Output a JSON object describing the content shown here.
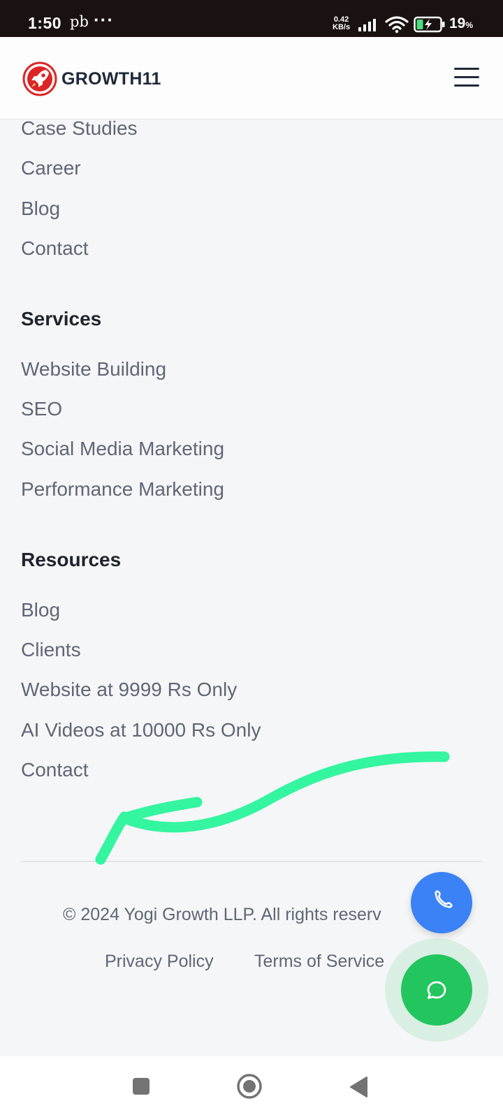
{
  "status_bar": {
    "time": "1:50",
    "carrier": "pb",
    "dots": "···",
    "net_speed_value": "0.42",
    "net_speed_unit": "KB/s",
    "battery_percent": "19",
    "battery_unit": "%"
  },
  "header": {
    "logo_text": "GROWTH11",
    "brand_color": "#dc2626"
  },
  "company": {
    "links": [
      "Case Studies",
      "Career",
      "Blog",
      "Contact"
    ]
  },
  "services": {
    "heading": "Services",
    "links": [
      "Website Building",
      "SEO",
      "Social Media Marketing",
      "Performance Marketing"
    ]
  },
  "resources": {
    "heading": "Resources",
    "links": [
      "Blog",
      "Clients",
      "Website at 9999 Rs Only",
      "AI Videos at 10000 Rs Only",
      "Contact"
    ]
  },
  "footer": {
    "copyright": "© 2024 Yogi Growth LLP. All rights reserv",
    "privacy": "Privacy Policy",
    "terms": "Terms of Service"
  },
  "floating": {
    "call_icon": "phone-icon",
    "chat_icon": "chat-bubble-icon",
    "call_color": "#3b82f6",
    "chat_color": "#22c55e"
  },
  "annotation": {
    "color": "#34f5a0"
  },
  "nav": {
    "icons": [
      "recent-apps-icon",
      "home-icon",
      "back-icon"
    ]
  }
}
